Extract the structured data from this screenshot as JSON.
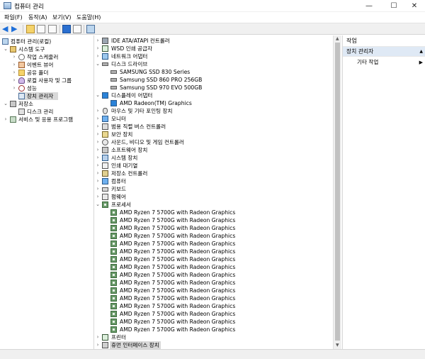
{
  "window": {
    "title": "컴퓨터 관리",
    "minimize": "—",
    "maximize": "☐",
    "close": "✕"
  },
  "menu": [
    "파일(F)",
    "동작(A)",
    "보기(V)",
    "도움말(H)"
  ],
  "toolbar": {
    "back": "◀",
    "forward": "▶",
    "icons": [
      "up-folder-icon",
      "show-hide-tree-icon",
      "export-list-icon",
      "help-icon",
      "properties-icon",
      "action-pane-icon"
    ]
  },
  "left_tree": {
    "root": "컴퓨터 관리(로컬)",
    "system_tools": "시스템 도구",
    "task_scheduler": "작업 스케줄러",
    "event_viewer": "이벤트 뷰어",
    "shared_folders": "공유 폴더",
    "local_users": "로컬 사용자 및 그룹",
    "performance": "성능",
    "device_manager": "장치 관리자",
    "storage": "저장소",
    "disk_management": "디스크 관리",
    "services": "서비스 및 응용 프로그램"
  },
  "device_tree": {
    "ide": "IDE ATA/ATAPI 컨트롤러",
    "wsd": "WSD 인쇄 공급자",
    "network": "네트워크 어댑터",
    "disk_drives": "디스크 드라이브",
    "disks": [
      "SAMSUNG SSD 830 Series",
      "Samsung SSD 860 PRO 256GB",
      "Samsung SSD 970 EVO 500GB"
    ],
    "display_adapters": "디스플레이 어댑터",
    "gpu": "AMD Radeon(TM) Graphics",
    "mouse": "마우스 및 기타 포인팅 장치",
    "monitor": "모니터",
    "usb": "범용 직렬 버스 컨트롤러",
    "security": "보안 장치",
    "audio": "사운드, 비디오 및 게임 컨트롤러",
    "software": "소프트웨어 장치",
    "system": "시스템 장치",
    "print_queue": "인쇄 대기열",
    "storage_ctl": "저장소 컨트롤러",
    "computer": "컴퓨터",
    "keyboard": "키보드",
    "firmware": "펌웨어",
    "processors": "프로세서",
    "cpus": [
      "AMD Ryzen 7 5700G with Radeon Graphics",
      "AMD Ryzen 7 5700G with Radeon Graphics",
      "AMD Ryzen 7 5700G with Radeon Graphics",
      "AMD Ryzen 7 5700G with Radeon Graphics",
      "AMD Ryzen 7 5700G with Radeon Graphics",
      "AMD Ryzen 7 5700G with Radeon Graphics",
      "AMD Ryzen 7 5700G with Radeon Graphics",
      "AMD Ryzen 7 5700G with Radeon Graphics",
      "AMD Ryzen 7 5700G with Radeon Graphics",
      "AMD Ryzen 7 5700G with Radeon Graphics",
      "AMD Ryzen 7 5700G with Radeon Graphics",
      "AMD Ryzen 7 5700G with Radeon Graphics",
      "AMD Ryzen 7 5700G with Radeon Graphics",
      "AMD Ryzen 7 5700G with Radeon Graphics",
      "AMD Ryzen 7 5700G with Radeon Graphics",
      "AMD Ryzen 7 5700G with Radeon Graphics"
    ],
    "printers": "프린터",
    "hid": "휴먼 인터페이스 장치"
  },
  "actions": {
    "header": "작업",
    "device_manager": "장치 관리자",
    "more_actions": "기타 작업"
  }
}
